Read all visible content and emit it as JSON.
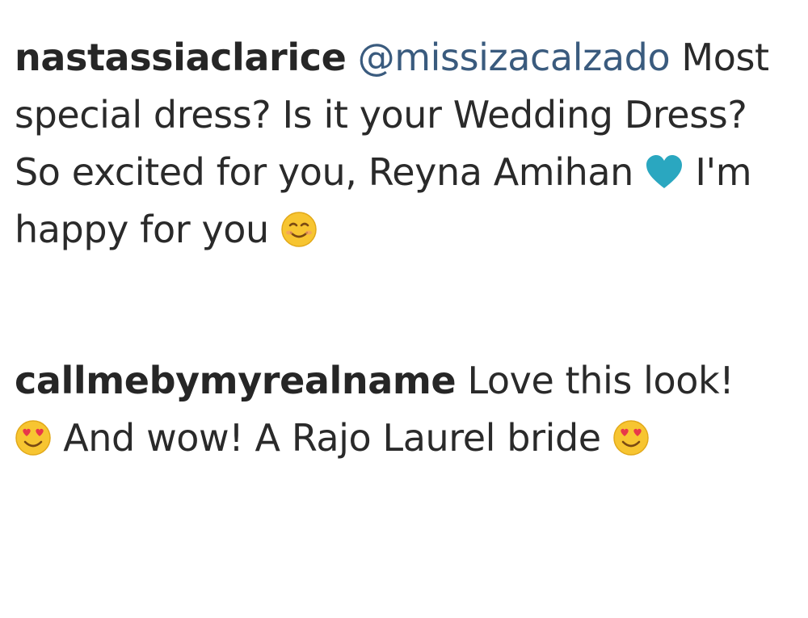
{
  "comments": [
    {
      "username": "nastassiaclarice",
      "mention": "@missizacalzado",
      "text_before_heart": "Most special dress? Is it your Wedding Dress? So excited for you, Reyna Amihan",
      "text_after_heart": "I'm happy for you",
      "icons": [
        "blue-heart-icon",
        "smiling-face-icon"
      ]
    },
    {
      "username": "callmebymyrealname",
      "text_first": "Love this look!",
      "text_middle": "And wow! A Rajo Laurel bride",
      "icons": [
        "heart-eyes-face-icon",
        "heart-eyes-face-icon"
      ]
    }
  ],
  "colors": {
    "text": "#262626",
    "mention": "#3a5b7e",
    "heart": "#2aa7c0",
    "emoji_face": "#f7c531"
  }
}
